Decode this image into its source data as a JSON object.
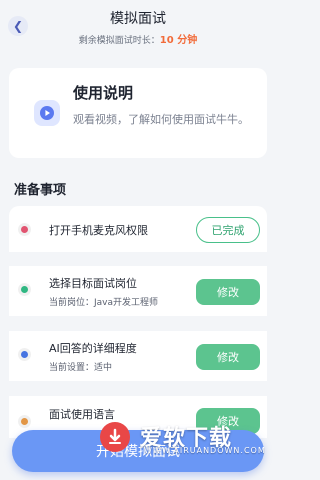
{
  "header": {
    "title": "模拟面试",
    "remaining_label": "剩余模拟面试时长：",
    "remaining_value": "10 分钟"
  },
  "instructions": {
    "title": "使用说明",
    "description": "观看视频，了解如何使用面试牛牛。",
    "icon": "play-icon"
  },
  "prep": {
    "section_title": "准备事项",
    "items": [
      {
        "title": "打开手机麦克风权限",
        "subtitle": "",
        "action": "已完成",
        "dot_color": "#f05a78"
      },
      {
        "title": "选择目标面试岗位",
        "subtitle": "当前岗位：Java开发工程师",
        "action": "修改",
        "dot_color": "#33c38b"
      },
      {
        "title": "AI回答的详细程度",
        "subtitle": "当前设置：适中",
        "action": "修改",
        "dot_color": "#4b7cf0"
      },
      {
        "title": "面试使用语言",
        "subtitle": "",
        "action": "修改",
        "dot_color": "#f1a04b"
      }
    ]
  },
  "cta": {
    "label": "开始模拟面试"
  },
  "watermark": {
    "text": "爱软下载",
    "url": "WWW.AIRUANDOWN.COM"
  },
  "colors": {
    "accent": "#6a97f5",
    "success": "#5cc48f",
    "highlight": "#f26b3a"
  }
}
